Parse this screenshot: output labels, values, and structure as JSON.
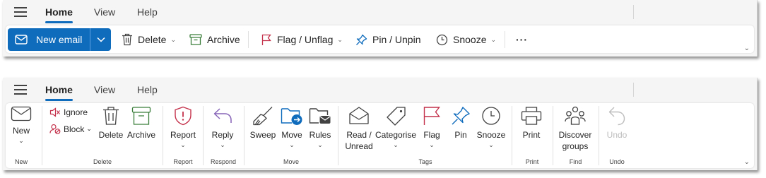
{
  "simplified": {
    "tabs": [
      {
        "label": "Home",
        "active": true
      },
      {
        "label": "View"
      },
      {
        "label": "Help"
      }
    ],
    "new_email": "New email",
    "delete": "Delete",
    "archive": "Archive",
    "flag": "Flag / Unflag",
    "pin": "Pin / Unpin",
    "snooze": "Snooze",
    "more": "···"
  },
  "classic": {
    "tabs": [
      {
        "label": "Home",
        "active": true
      },
      {
        "label": "View"
      },
      {
        "label": "Help"
      }
    ],
    "new": {
      "label": "New",
      "group": "New"
    },
    "delete_group": {
      "ignore": "Ignore",
      "block": "Block",
      "delete": "Delete",
      "archive": "Archive",
      "group": "Delete"
    },
    "report": {
      "label": "Report",
      "group": "Report"
    },
    "respond": {
      "label": "Reply",
      "group": "Respond"
    },
    "move_group": {
      "sweep": "Sweep",
      "move": "Move",
      "rules": "Rules",
      "group": "Move"
    },
    "tags_group": {
      "read_unread_1": "Read /",
      "read_unread_2": "Unread",
      "categorise": "Categorise",
      "flag": "Flag",
      "pin": "Pin",
      "snooze": "Snooze",
      "group": "Tags"
    },
    "print": {
      "label": "Print",
      "group": "Print"
    },
    "find": {
      "label1": "Discover",
      "label2": "groups",
      "group": "Find"
    },
    "undo": {
      "label": "Undo",
      "group": "Undo"
    }
  },
  "colors": {
    "accent": "#0f6cbd",
    "archive_green": "#3a7d3a",
    "flag_red": "#c4314b",
    "report_red": "#c4314b",
    "reply_purple": "#8764b8"
  }
}
